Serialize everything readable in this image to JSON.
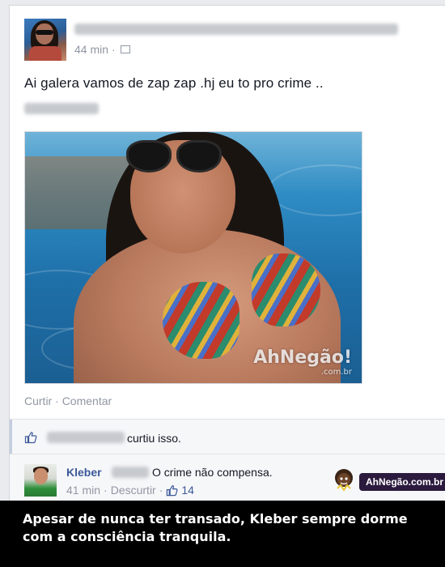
{
  "post": {
    "time": "44 min",
    "separator": "·",
    "text": "Ai galera vamos de zap zap .hj eu to pro crime ..",
    "watermark": "AhNegão!",
    "watermark_sub": ".com.br"
  },
  "actions": {
    "like": "Curtir",
    "dot": "·",
    "comment": "Comentar"
  },
  "likes": {
    "text": "curtiu isso."
  },
  "comment": {
    "author": "Kleber",
    "text": "O crime não compensa.",
    "time": "41 min",
    "dot": "·",
    "unlike": "Descurtir",
    "like_count": "14"
  },
  "badge": {
    "label": "AhNegão.com.br"
  },
  "caption": {
    "text": "Apesar de nunca ter transado, Kleber sempre dorme com a consciência tranquila."
  },
  "colors": {
    "link": "#3b5998",
    "muted": "#9197a3",
    "caption_bg": "#000000"
  }
}
